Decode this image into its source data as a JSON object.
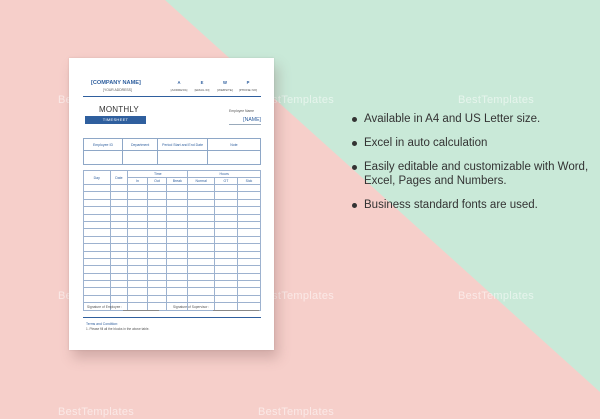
{
  "background": {
    "pink": "#f6cfca",
    "mint": "#c9e9d8"
  },
  "watermark": "BestTemplates",
  "document": {
    "company": "[COMPANY NAME]",
    "address": "[YOUR ADDRESS]",
    "contacts": [
      {
        "key": "A",
        "value": "[ADDRESS]"
      },
      {
        "key": "E",
        "value": "[EMAIL ID]"
      },
      {
        "key": "W",
        "value": "[WEBSITE]"
      },
      {
        "key": "P",
        "value": "[PHONE NO]"
      }
    ],
    "title": "MONTHLY",
    "subtitle": "TIMESHEET",
    "employee_label": "Employee Name",
    "employee_name": "[NAME]",
    "info_headers": [
      "Employee ID",
      "Department",
      "Period Start and End Date",
      "Note"
    ],
    "main_headers": {
      "day": "Day",
      "date": "Date",
      "time": "Time",
      "in": "In",
      "out": "Out",
      "break": "Break",
      "hours": "Hours",
      "normal": "Normal",
      "ot": "OT",
      "sick": "Sick"
    },
    "signature_employee": "Signature of Employee :",
    "signature_supervisor": "Signature of Supervisor :",
    "terms_title": "Terms and Condition:",
    "terms_item": "1. Please fill all the blocks in the above table."
  },
  "features": [
    "Available in A4 and US Letter size.",
    "Excel in auto calculation",
    "Easily editable and customizable with Word, Excel, Pages and Numbers.",
    "Business standard fonts are used."
  ]
}
